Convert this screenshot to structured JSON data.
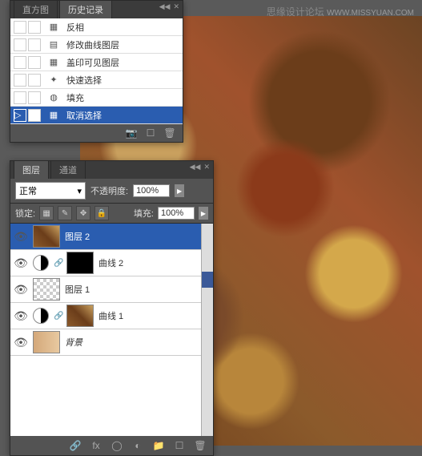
{
  "watermark": {
    "text": "思缘设计论坛",
    "url": "WWW.MISSYUAN.COM"
  },
  "history_panel": {
    "tabs": [
      {
        "label": "直方图",
        "active": false
      },
      {
        "label": "历史记录",
        "active": true
      }
    ],
    "items": [
      {
        "icon": "invert",
        "label": "反相"
      },
      {
        "icon": "curves",
        "label": "修改曲线图层"
      },
      {
        "icon": "stamp",
        "label": "盖印可见图层"
      },
      {
        "icon": "wand",
        "label": "快速选择"
      },
      {
        "icon": "fill",
        "label": "填充"
      },
      {
        "icon": "deselect",
        "label": "取消选择",
        "selected": true
      }
    ]
  },
  "layers_panel": {
    "tabs": [
      {
        "label": "图层",
        "active": true
      },
      {
        "label": "通道",
        "active": false
      }
    ],
    "blend_mode": "正常",
    "opacity_label": "不透明度:",
    "opacity_value": "100%",
    "lock_label": "锁定:",
    "fill_label": "填充:",
    "fill_value": "100%",
    "layers": [
      {
        "thumb": "leaves",
        "name": "图层 2",
        "selected": true
      },
      {
        "thumb": "black",
        "adj": true,
        "name": "曲线 2"
      },
      {
        "thumb": "checker",
        "name": "图层 1"
      },
      {
        "thumb": "leaves",
        "adj": true,
        "name": "曲线 1"
      },
      {
        "thumb": "photo",
        "name": "背景",
        "italic": true
      }
    ]
  }
}
